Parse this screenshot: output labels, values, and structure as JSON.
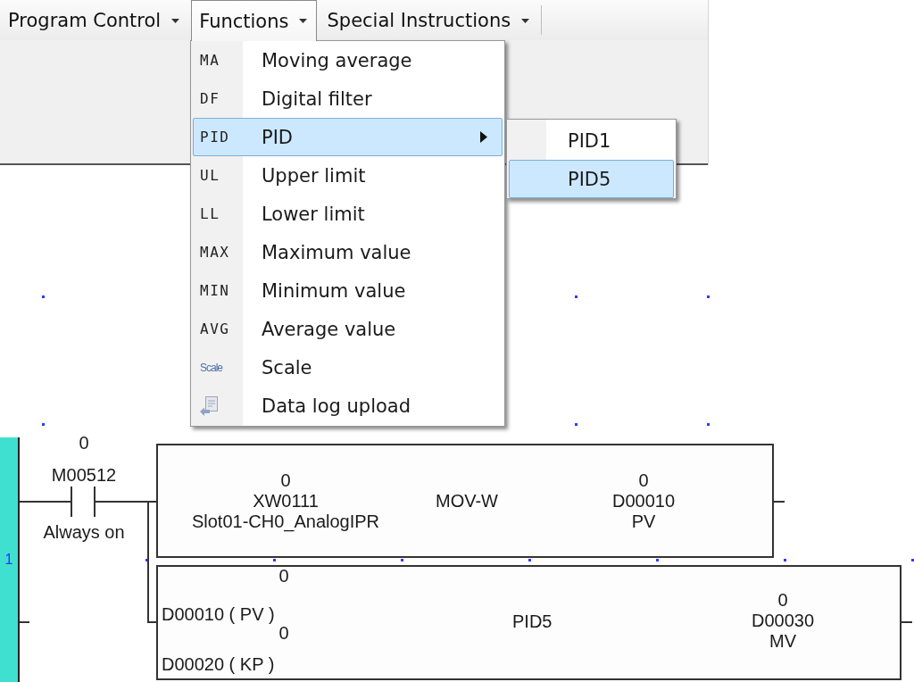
{
  "menu_bar": {
    "items": [
      {
        "label": "Program Control",
        "open": false
      },
      {
        "label": "Functions",
        "open": true
      },
      {
        "label": "Special Instructions",
        "open": false
      }
    ]
  },
  "functions_menu": {
    "items": [
      {
        "kind": "code",
        "code": "MA",
        "label": "Moving average",
        "selected": false,
        "submenu": false
      },
      {
        "kind": "code",
        "code": "DF",
        "label": "Digital filter",
        "selected": false,
        "submenu": false
      },
      {
        "kind": "code",
        "code": "PID",
        "label": "PID",
        "selected": true,
        "submenu": true
      },
      {
        "kind": "code",
        "code": "UL",
        "label": "Upper limit",
        "selected": false,
        "submenu": false
      },
      {
        "kind": "code",
        "code": "LL",
        "label": "Lower limit",
        "selected": false,
        "submenu": false
      },
      {
        "kind": "code",
        "code": "MAX",
        "label": "Maximum value",
        "selected": false,
        "submenu": false
      },
      {
        "kind": "code",
        "code": "MIN",
        "label": "Minimum value",
        "selected": false,
        "submenu": false
      },
      {
        "kind": "code",
        "code": "AVG",
        "label": "Average value",
        "selected": false,
        "submenu": false
      },
      {
        "kind": "tiny",
        "code": "Scale",
        "label": "Scale",
        "selected": false,
        "submenu": false
      },
      {
        "kind": "image",
        "label": "Data log upload",
        "selected": false,
        "submenu": false
      }
    ]
  },
  "pid_submenu": {
    "items": [
      {
        "label": "PID1",
        "selected": false
      },
      {
        "label": "PID5",
        "selected": true
      }
    ]
  },
  "ladder": {
    "rung_number": "1",
    "contact": {
      "value": "0",
      "address": "M00512",
      "comment": "Always on"
    },
    "blocks": [
      {
        "kind": "move",
        "instruction": "MOV-W",
        "source": {
          "value": "0",
          "address": "XW0111",
          "comment": "Slot01-CH0_AnalogIPR"
        },
        "destination": {
          "value": "0",
          "address": "D00010",
          "comment": "PV"
        }
      },
      {
        "kind": "pid",
        "instruction": "PID5",
        "inputs": [
          {
            "value": "0",
            "operand": "D00010 ( PV )"
          },
          {
            "value": "0",
            "operand": "D00020 ( KP )"
          }
        ],
        "output": {
          "value": "0",
          "address": "D00030",
          "comment": "MV"
        }
      }
    ]
  }
}
